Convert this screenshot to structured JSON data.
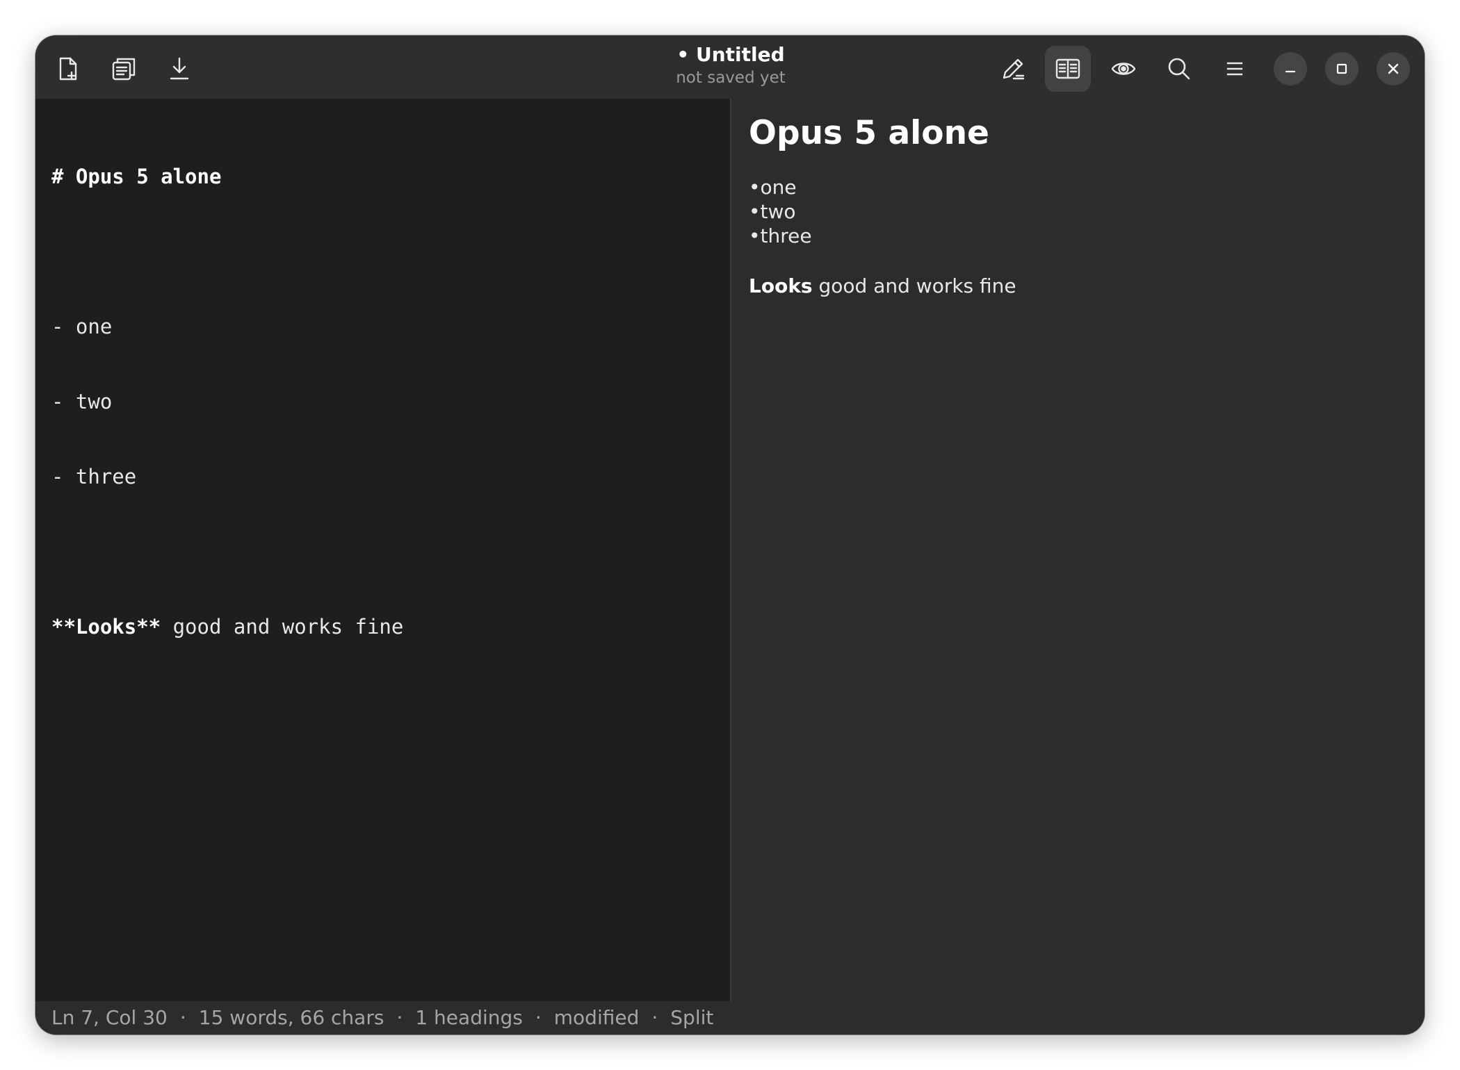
{
  "header": {
    "title": "• Untitled",
    "subtitle": "not saved yet",
    "left_icons": [
      "new-document-icon",
      "copy-icon",
      "download-icon"
    ],
    "right_icons": [
      "edit-pencil-icon",
      "split-view-icon",
      "preview-eye-icon",
      "search-icon",
      "menu-icon"
    ],
    "active_view": "split-view-icon",
    "window_controls": [
      "minimize-icon",
      "maximize-icon",
      "close-icon"
    ]
  },
  "editor": {
    "lines": [
      "# Opus 5 alone",
      "",
      "- one",
      "- two",
      "- three",
      "",
      "**Looks** good and works fine"
    ],
    "last_line_bold": "**Looks**",
    "last_line_rest": " good and works fine"
  },
  "preview": {
    "heading": "Opus 5 alone",
    "list": [
      "one",
      "two",
      "three"
    ],
    "para_bold": "Looks",
    "para_rest": " good and works fine"
  },
  "status": {
    "position": "Ln 7, Col 30",
    "counts": "15 words, 66 chars",
    "headings": "1 headings",
    "state": "modified",
    "view": "Split",
    "separator": "·"
  },
  "colors": {
    "window_bg": "#2c2c2c",
    "editor_bg": "#1e1e1f",
    "headerbar_bg": "#2e2e2e",
    "active_button_bg": "#434343",
    "text": "#e8e8e8",
    "muted_text": "#a6a6a6"
  }
}
